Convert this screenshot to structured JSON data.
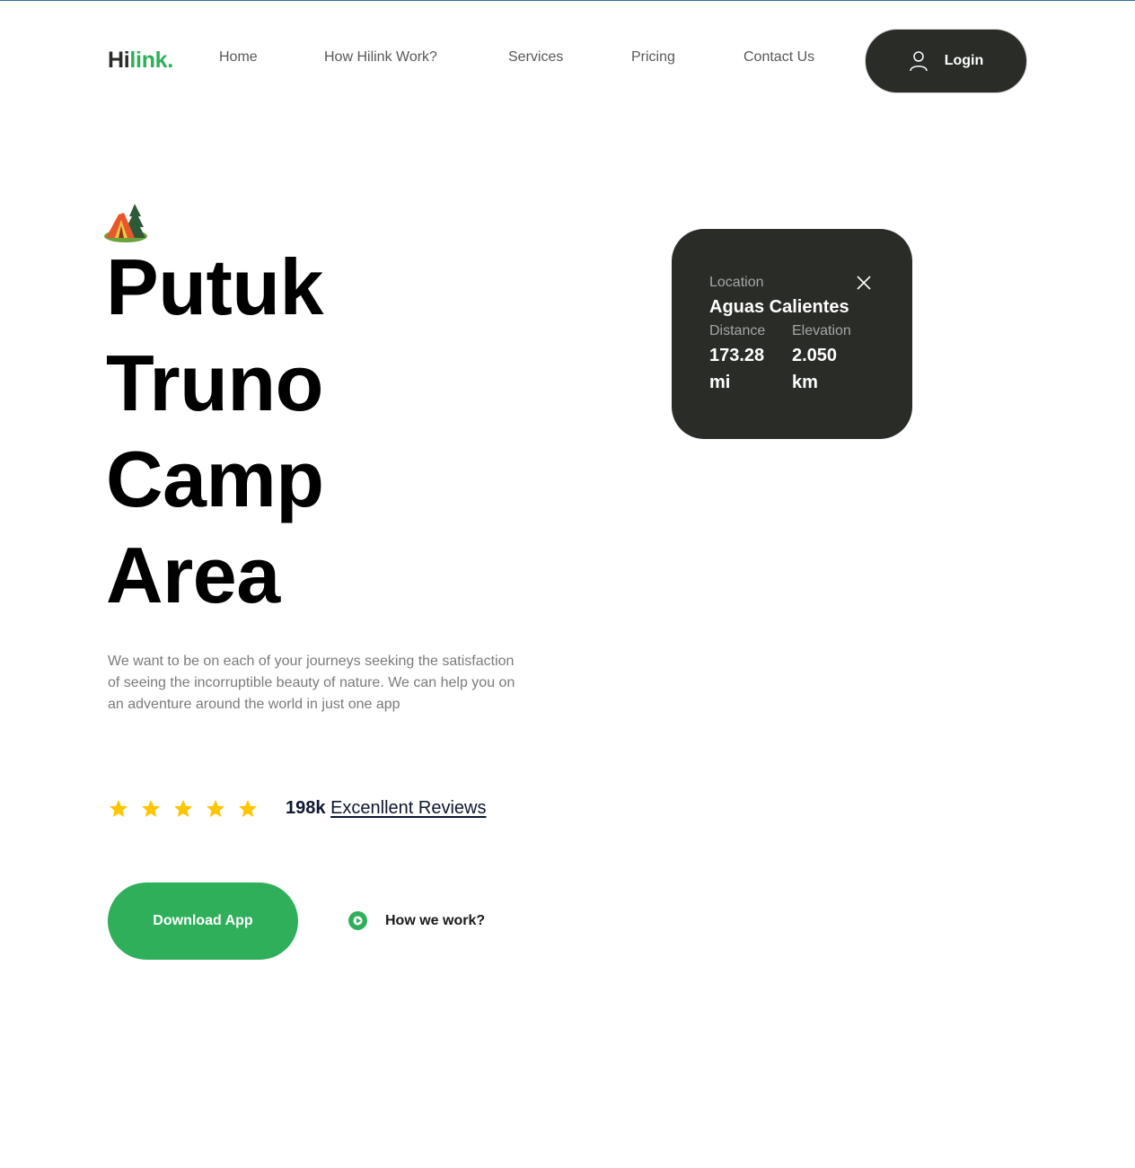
{
  "header": {
    "logo_part1": "Hi",
    "logo_part2": "link.",
    "nav": [
      {
        "label": "Home"
      },
      {
        "label": "How Hilink Work?"
      },
      {
        "label": "Services"
      },
      {
        "label": "Pricing"
      },
      {
        "label": "Contact Us"
      }
    ],
    "login_label": "Login",
    "login_icon": "user-icon"
  },
  "hero": {
    "icon": "camp-tent-icon",
    "title_lines": [
      "Putuk",
      "Truno",
      "Camp",
      "Area"
    ],
    "description": "We want to be on each of your journeys seeking the satisfaction of seeing the incorruptible beauty of nature. We can help you on an adventure around the world in just one app",
    "rating_stars": 5,
    "rating_max": 5,
    "reviews_count": "198k",
    "reviews_label": "Excenllent Reviews",
    "download_label": "Download App",
    "how_label": "How we work?"
  },
  "location_card": {
    "location_label": "Location",
    "location_value": "Aguas Calientes",
    "distance_label": "Distance",
    "distance_value": "173.28",
    "distance_unit": "mi",
    "elevation_label": "Elevation",
    "elevation_value": "2.050",
    "elevation_unit": "km"
  },
  "colors": {
    "brand_green": "#30af5b",
    "dark": "#292c27",
    "star": "#fec601",
    "muted_text": "#7b7b7b"
  }
}
